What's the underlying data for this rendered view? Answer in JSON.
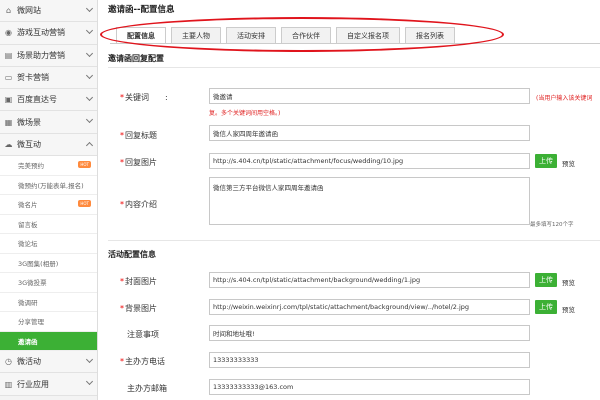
{
  "sidebar": {
    "items": [
      {
        "label": "微网站",
        "icon": "home-icon",
        "expanded": false
      },
      {
        "label": "游戏互动营销",
        "icon": "gamepad-icon",
        "expanded": false
      },
      {
        "label": "场景助力营销",
        "icon": "scene-icon",
        "expanded": false
      },
      {
        "label": "贺卡营销",
        "icon": "card-icon",
        "expanded": false
      },
      {
        "label": "百度直达号",
        "icon": "baidu-icon",
        "expanded": false
      },
      {
        "label": "微场景",
        "icon": "scene-grid-icon",
        "expanded": false
      },
      {
        "label": "微互动",
        "icon": "chat-icon",
        "expanded": true
      }
    ],
    "sub_items": [
      {
        "label": "完美预约",
        "hot": true
      },
      {
        "label": "微预约(万能表单,报名)",
        "hot": false
      },
      {
        "label": "微名片",
        "hot": true
      },
      {
        "label": "留言板",
        "hot": false
      },
      {
        "label": "微论坛",
        "hot": false
      },
      {
        "label": "3G图集(相册)",
        "hot": false
      },
      {
        "label": "3G微投票",
        "hot": false
      },
      {
        "label": "微调研",
        "hot": false
      },
      {
        "label": "分享管理",
        "hot": false
      },
      {
        "label": "邀请函",
        "hot": false,
        "active": true
      }
    ],
    "bottom_items": [
      {
        "label": "微活动",
        "icon": "activity-icon"
      },
      {
        "label": "行业应用",
        "icon": "industry-icon"
      }
    ],
    "hot_badge": "HOT"
  },
  "header": {
    "title": "邀请函--配置信息"
  },
  "tabs": [
    "配置信息",
    "主要人物",
    "活动安排",
    "合作伙伴",
    "自定义报名项",
    "报名列表"
  ],
  "reply_section": {
    "title": "邀请函回复配置",
    "keyword_label": "关键词",
    "keyword_value": "微邀请",
    "keyword_hint1": "(当用户输入该关键词",
    "keyword_hint2": "复。多个关键词间用空格。)",
    "reply_title_label": "回复标题",
    "reply_title_value": "微信人家四周年邀请函",
    "reply_image_label": "回复图片",
    "reply_image_value": "http://s.404.cn/tpl/static/attachment/focus/wedding/10.jpg",
    "intro_label": "内容介绍",
    "intro_value": "微信第三方平台微信人家四周年邀请函",
    "intro_maxlen": "最多填写120个字"
  },
  "activity_section": {
    "title": "活动配置信息",
    "cover_label": "封面图片",
    "cover_value": "http://s.404.cn/tpl/static/attachment/background/wedding/1.jpg",
    "bg_label": "背景图片",
    "bg_value": "http://weixin.weixinrj.com/tpl/static/attachment/background/view/../hotel/2.jpg",
    "notes_label": "注意事项",
    "notes_value": "时间和地址哦!",
    "phone_label": "主办方电话",
    "phone_value": "13333333333",
    "email_label": "主办方邮箱",
    "email_value": "13333333333@163.com"
  },
  "buttons": {
    "upload": "上传",
    "preview": "预览"
  },
  "colors": {
    "accent": "#3cb035",
    "highlight_ellipse": "#e0141c",
    "required": "#e00000"
  }
}
